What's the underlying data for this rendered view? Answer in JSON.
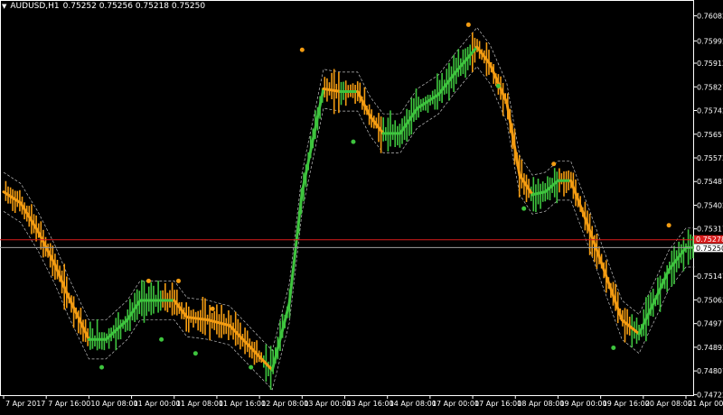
{
  "header": {
    "symbol": "AUDUSD,H1",
    "ohlc": "0.75252 0.75256 0.75218 0.75250"
  },
  "price_axis": {
    "ticks": [
      "0.76082",
      "0.75992",
      "0.75912",
      "0.75827",
      "0.75742",
      "0.75657",
      "0.75572",
      "0.75487",
      "0.75402",
      "0.75317",
      "0.75147",
      "0.75062",
      "0.74977",
      "0.74892",
      "0.74807",
      "0.74722"
    ],
    "bid_label": "0.75250",
    "ask_label": "0.75278"
  },
  "time_axis": {
    "labels": [
      "7 Apr 2017",
      "7 Apr 16:00",
      "10 Apr 08:00",
      "11 Apr 00:00",
      "11 Apr 08:00",
      "11 Apr 16:00",
      "12 Apr 08:00",
      "13 Apr 00:00",
      "13 Apr 16:00",
      "14 Apr 08:00",
      "17 Apr 00:00",
      "17 Apr 16:00",
      "18 Apr 08:00",
      "19 Apr 00:00",
      "19 Apr 16:00",
      "20 Apr 08:00",
      "21 Apr 00:00"
    ]
  },
  "colors": {
    "bull": "#3ec43e",
    "bear": "#f39c12",
    "band": "#bdbdbd",
    "ask_line": "#d91c1c",
    "bid_line": "#9e9e9e"
  },
  "chart_data": {
    "type": "line",
    "symbol": "AUDUSD",
    "timeframe": "H1",
    "ylim": [
      0.7472,
      0.761
    ],
    "price_ticks": [
      0.76082,
      0.75992,
      0.75912,
      0.75827,
      0.75742,
      0.75657,
      0.75572,
      0.75487,
      0.75402,
      0.75317,
      0.75147,
      0.75062,
      0.74977,
      0.74892,
      0.74807,
      0.74722
    ],
    "current_bid": 0.7525,
    "current_ask": 0.75278,
    "x_labels": [
      "7 Apr 2017",
      "7 Apr 16:00",
      "10 Apr 08:00",
      "11 Apr 00:00",
      "11 Apr 08:00",
      "11 Apr 16:00",
      "12 Apr 08:00",
      "13 Apr 00:00",
      "13 Apr 16:00",
      "14 Apr 08:00",
      "17 Apr 00:00",
      "17 Apr 16:00",
      "18 Apr 08:00",
      "19 Apr 00:00",
      "19 Apr 16:00",
      "20 Apr 08:00",
      "21 Apr 00:00"
    ],
    "x_positions": [
      0,
      1,
      2,
      3,
      4,
      5,
      6,
      7,
      8,
      9,
      10,
      11,
      12,
      13,
      14,
      15,
      16
    ],
    "trend_line": [
      [
        0.0,
        0.7545
      ],
      [
        0.4,
        0.7541
      ],
      [
        0.8,
        0.7531
      ],
      [
        1.2,
        0.7519
      ],
      [
        1.5,
        0.7508
      ],
      [
        2.0,
        0.7492
      ],
      [
        2.4,
        0.7492
      ],
      [
        2.9,
        0.7499
      ],
      [
        3.2,
        0.7506
      ],
      [
        3.5,
        0.7506
      ],
      [
        4.0,
        0.7506
      ],
      [
        4.3,
        0.75
      ],
      [
        4.8,
        0.7499
      ],
      [
        5.3,
        0.7497
      ],
      [
        5.8,
        0.7489
      ],
      [
        6.3,
        0.7481
      ],
      [
        6.7,
        0.7505
      ],
      [
        7.0,
        0.7545
      ],
      [
        7.5,
        0.7582
      ],
      [
        7.9,
        0.7581
      ],
      [
        8.3,
        0.7581
      ],
      [
        8.6,
        0.7572
      ],
      [
        8.9,
        0.7566
      ],
      [
        9.3,
        0.7566
      ],
      [
        9.7,
        0.7575
      ],
      [
        10.2,
        0.758
      ],
      [
        10.6,
        0.7588
      ],
      [
        11.1,
        0.7597
      ],
      [
        11.4,
        0.7591
      ],
      [
        11.8,
        0.7577
      ],
      [
        12.1,
        0.7551
      ],
      [
        12.4,
        0.7544
      ],
      [
        12.7,
        0.7545
      ],
      [
        13.0,
        0.7549
      ],
      [
        13.3,
        0.7549
      ],
      [
        13.7,
        0.7533
      ],
      [
        14.1,
        0.7516
      ],
      [
        14.5,
        0.7499
      ],
      [
        14.9,
        0.7494
      ],
      [
        15.3,
        0.7507
      ],
      [
        15.6,
        0.7517
      ],
      [
        16.0,
        0.7525
      ],
      [
        16.2,
        0.7525
      ]
    ],
    "dots": [
      {
        "x": 2.3,
        "y": 0.7482,
        "trend": "up"
      },
      {
        "x": 3.4,
        "y": 0.7513,
        "trend": "down"
      },
      {
        "x": 3.7,
        "y": 0.7492,
        "trend": "up"
      },
      {
        "x": 4.1,
        "y": 0.7513,
        "trend": "down"
      },
      {
        "x": 4.5,
        "y": 0.7487,
        "trend": "up"
      },
      {
        "x": 4.9,
        "y": 0.7503,
        "trend": "down"
      },
      {
        "x": 5.8,
        "y": 0.7482,
        "trend": "up"
      },
      {
        "x": 7.0,
        "y": 0.7596,
        "trend": "down"
      },
      {
        "x": 8.2,
        "y": 0.7563,
        "trend": "up"
      },
      {
        "x": 10.9,
        "y": 0.7605,
        "trend": "down"
      },
      {
        "x": 11.6,
        "y": 0.7583,
        "trend": "up"
      },
      {
        "x": 12.2,
        "y": 0.7539,
        "trend": "up"
      },
      {
        "x": 12.9,
        "y": 0.7555,
        "trend": "down"
      },
      {
        "x": 14.3,
        "y": 0.7489,
        "trend": "up"
      },
      {
        "x": 15.6,
        "y": 0.7533,
        "trend": "down"
      }
    ],
    "grid": false
  }
}
